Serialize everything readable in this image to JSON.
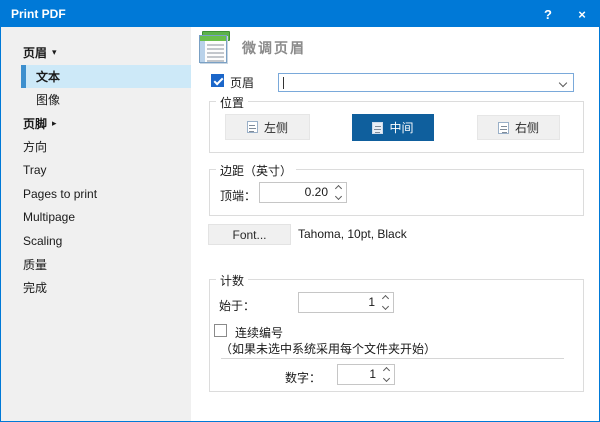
{
  "window": {
    "title": "Print PDF",
    "help_label": "?",
    "close_label": "×"
  },
  "sidebar": {
    "items": [
      {
        "label": "页眉",
        "arrow": "▾"
      },
      {
        "label": "文本"
      },
      {
        "label": "图像"
      },
      {
        "label": "页脚",
        "arrow": "▸"
      },
      {
        "label": "方向"
      },
      {
        "label": "Tray"
      },
      {
        "label": "Pages to print"
      },
      {
        "label": "Multipage"
      },
      {
        "label": "Scaling"
      },
      {
        "label": "质量"
      },
      {
        "label": "完成"
      }
    ]
  },
  "main": {
    "page_title": "微调页眉",
    "header_checkbox": {
      "label": "页眉",
      "checked": true
    },
    "header_combobox": {
      "value": ""
    },
    "position_group": {
      "label": "位置",
      "buttons": [
        {
          "label": "左侧",
          "selected": false
        },
        {
          "label": "中间",
          "selected": true
        },
        {
          "label": "右侧",
          "selected": false
        }
      ]
    },
    "margin_group": {
      "label": "边距（英寸）",
      "top_label": "顶端：",
      "top_value": "0.20"
    },
    "font": {
      "button_label": "Font...",
      "description": "Tahoma, 10pt, Black"
    },
    "count_group": {
      "label": "计数",
      "start_label": "始于：",
      "start_value": "1",
      "continuous_checkbox": {
        "label": "连续编号",
        "checked": false
      },
      "note": "（如果未选中系统采用每个文件夹开始）",
      "number_label": "数字：",
      "number_value": "1"
    }
  },
  "colors": {
    "titlebar": "#0079d7",
    "primary_button": "#0f5f9d",
    "sidebar_selected_bg": "#cde9f8",
    "sidebar_selected_accent": "#3c8fce",
    "checkbox_checked": "#1b66c9"
  }
}
